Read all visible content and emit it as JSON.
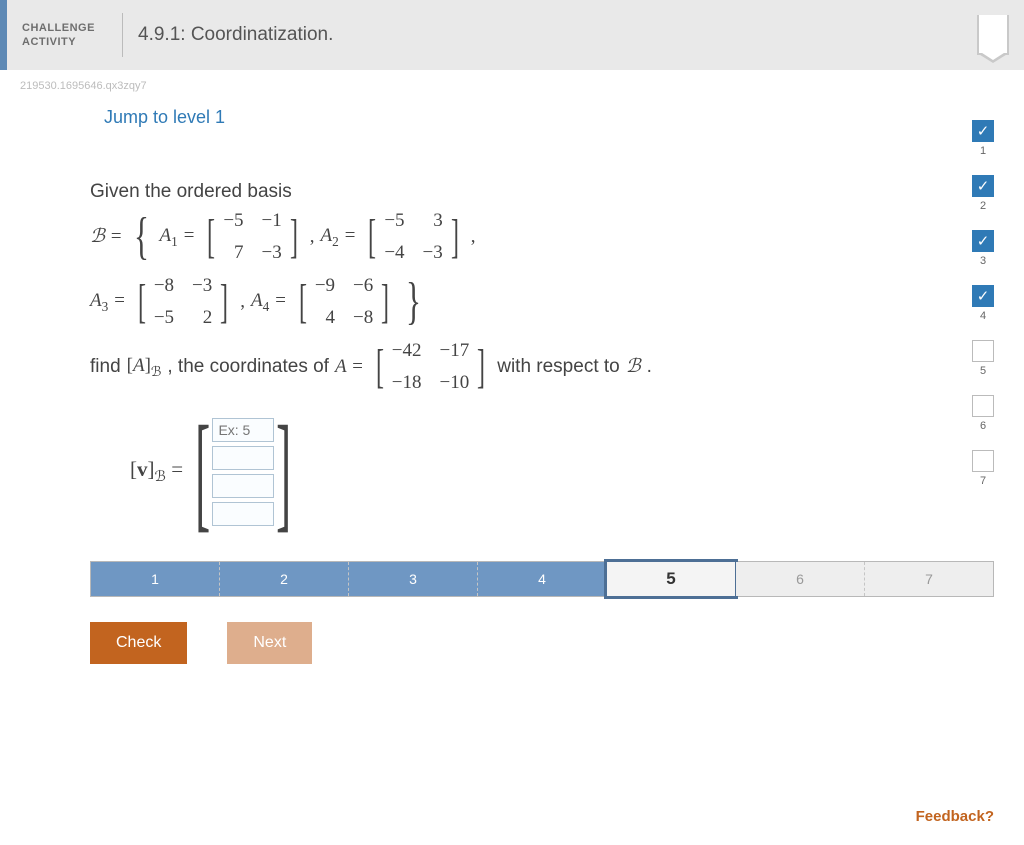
{
  "header": {
    "tag_line1": "CHALLENGE",
    "tag_line2": "ACTIVITY",
    "title": "4.9.1: Coordinatization."
  },
  "activity_id": "219530.1695646.qx3zqy7",
  "jump_link": "Jump to level 1",
  "problem": {
    "intro": "Given the ordered basis",
    "basis_symbol": "ℒ",
    "B": "B",
    "A1_label": "A₁",
    "A2_label": "A₂",
    "A3_label": "A₃",
    "A4_label": "A₄",
    "A1": [
      [
        "−5",
        "−1"
      ],
      [
        "7",
        "−3"
      ]
    ],
    "A2": [
      [
        "−5",
        "3"
      ],
      [
        "−4",
        "−3"
      ]
    ],
    "A3": [
      [
        "−8",
        "−3"
      ],
      [
        "−5",
        "2"
      ]
    ],
    "A4": [
      [
        "−9",
        "−6"
      ],
      [
        "4",
        "−8"
      ]
    ],
    "find_text_prefix": "find ",
    "find_AB": "[A]",
    "find_sub": "ℒ",
    "coords_text": ", the coordinates of ",
    "A_eq": "A",
    "Amatrix": [
      [
        "−42",
        "−17"
      ],
      [
        "−18",
        "−10"
      ]
    ],
    "wrt_text": " with respect to ",
    "B2": "B",
    "period": ".",
    "vb_label": "[v]",
    "vb_sub": "ℒ",
    "input_placeholder": "Ex: 5"
  },
  "levels": {
    "items": [
      {
        "n": "1",
        "state": "done"
      },
      {
        "n": "2",
        "state": "done"
      },
      {
        "n": "3",
        "state": "done"
      },
      {
        "n": "4",
        "state": "done"
      },
      {
        "n": "5",
        "state": "current"
      },
      {
        "n": "6",
        "state": "todo"
      },
      {
        "n": "7",
        "state": "todo"
      }
    ]
  },
  "buttons": {
    "check": "Check",
    "next": "Next"
  },
  "feedback": "Feedback?",
  "progress": {
    "items": [
      {
        "n": "1",
        "done": true
      },
      {
        "n": "2",
        "done": true
      },
      {
        "n": "3",
        "done": true
      },
      {
        "n": "4",
        "done": true
      },
      {
        "n": "5",
        "done": false
      },
      {
        "n": "6",
        "done": false
      },
      {
        "n": "7",
        "done": false
      }
    ]
  },
  "checkmark": "✓"
}
